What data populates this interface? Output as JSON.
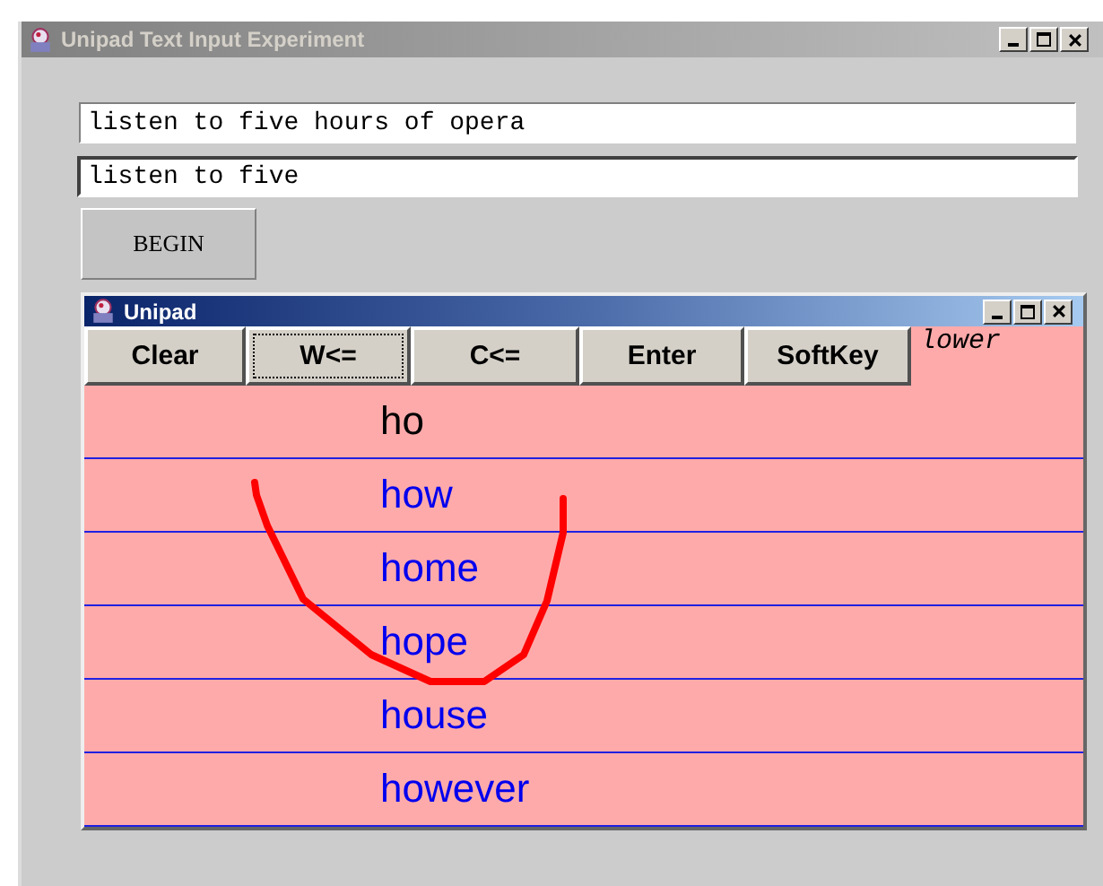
{
  "window": {
    "title": "Unipad Text Input Experiment",
    "active": false
  },
  "target_field": {
    "value": "listen to five hours of opera"
  },
  "input_field": {
    "value": "listen to five"
  },
  "begin_button": {
    "label": "BEGIN"
  },
  "unipad": {
    "title": "Unipad",
    "active": true,
    "buttons": [
      {
        "label": "Clear",
        "focused": false
      },
      {
        "label": "W<=",
        "focused": true
      },
      {
        "label": "C<=",
        "focused": false
      },
      {
        "label": "Enter",
        "focused": false
      },
      {
        "label": "SoftKey",
        "focused": false
      }
    ],
    "case_mode": "lower",
    "rows": [
      {
        "kind": "typed",
        "text": "ho"
      },
      {
        "kind": "suggestion",
        "text": "how"
      },
      {
        "kind": "suggestion",
        "text": "home"
      },
      {
        "kind": "suggestion",
        "text": "hope"
      },
      {
        "kind": "suggestion",
        "text": "house"
      },
      {
        "kind": "suggestion",
        "text": "however"
      }
    ]
  }
}
